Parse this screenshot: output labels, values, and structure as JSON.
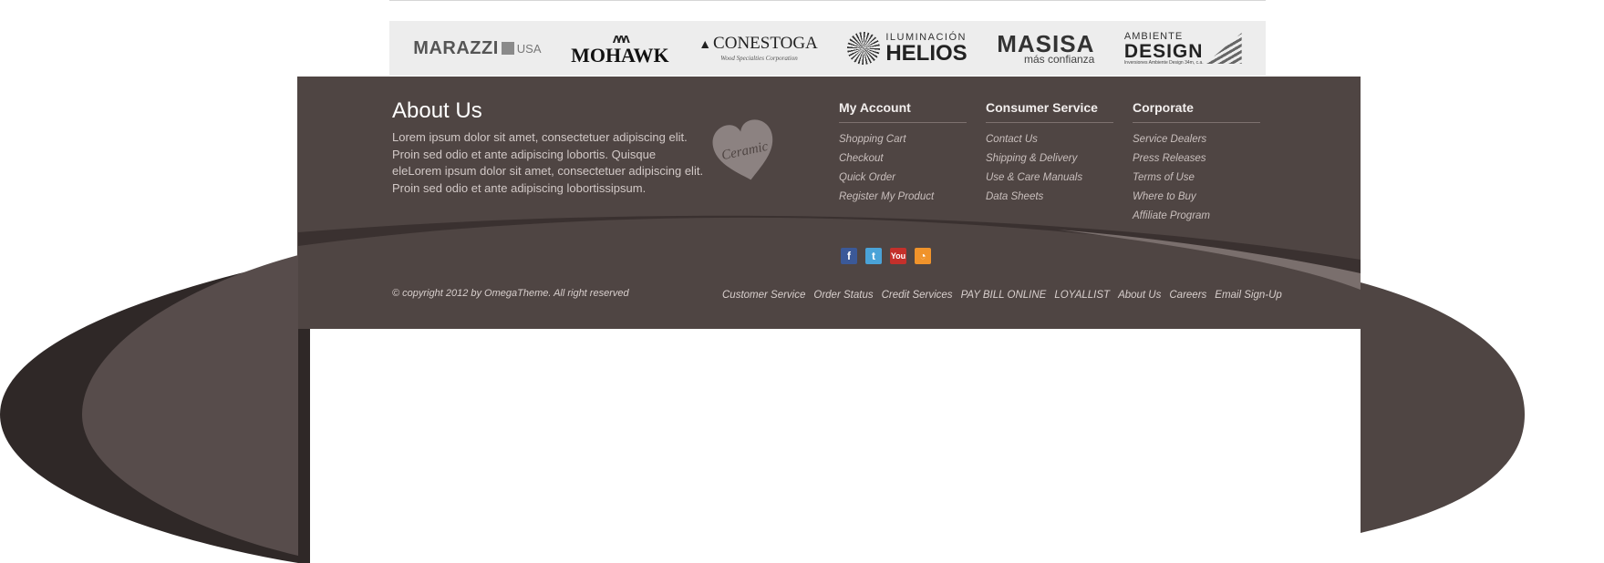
{
  "brands": [
    {
      "name": "MARAZZI",
      "suffix": "USA"
    },
    {
      "name": "MOHAWK"
    },
    {
      "name": "CONESTOGA",
      "sub": "Wood Specialties Corporation"
    },
    {
      "top": "ILUMINACIÓN",
      "name": "HELIOS"
    },
    {
      "name": "MASISA",
      "sub": "más confianza"
    },
    {
      "top": "AMBIENTE",
      "name": "DESIGN",
      "sub": "Inversiones Ambiente Design 34m, c.a."
    }
  ],
  "about": {
    "title": "About Us",
    "text": "Lorem ipsum dolor sit amet, consectetuer adipiscing elit. Proin sed odio et ante adipiscing lobortis. Quisque eleLorem ipsum dolor sit amet, consectetuer adipiscing elit. Proin sed odio et ante adipiscing lobortissipsum.",
    "badge": "Ceramic"
  },
  "columns": [
    {
      "title": "My Account",
      "links": [
        "Shopping Cart",
        "Checkout",
        "Quick Order",
        "Register My Product"
      ]
    },
    {
      "title": "Consumer Service",
      "links": [
        "Contact Us",
        "Shipping & Delivery",
        "Use & Care Manuals",
        "Data Sheets"
      ]
    },
    {
      "title": "Corporate",
      "links": [
        "Service Dealers",
        "Press Releases",
        "Terms of Use",
        "Where to Buy",
        "Affiliate Program"
      ]
    }
  ],
  "social": [
    {
      "glyph": "f",
      "icon": "facebook-icon"
    },
    {
      "glyph": "t",
      "icon": "twitter-icon"
    },
    {
      "glyph": "You",
      "icon": "youtube-icon"
    },
    {
      "glyph": "◔",
      "icon": "rss-icon"
    }
  ],
  "copyright": "© copyright 2012 by OmegaTheme. All right reserved",
  "bottom_nav": [
    "Customer Service",
    "Order Status",
    "Credit Services",
    "PAY BILL ONLINE",
    "LOYALLIST",
    "About Us",
    "Careers",
    "Email Sign-Up"
  ],
  "colors": {
    "footer_bg": "#4f4543",
    "swoosh_dark": "#2f2827",
    "swoosh_mid": "#574c4b",
    "brand_bar_bg": "#ededed"
  }
}
